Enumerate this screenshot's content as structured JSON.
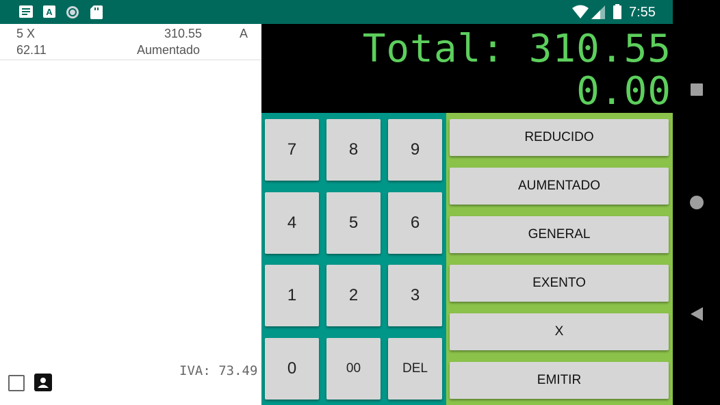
{
  "status_bar": {
    "time": "7:55",
    "icons": [
      "notes-icon",
      "font-icon",
      "sync-icon",
      "sd-card-icon",
      "wifi-icon",
      "signal-icon",
      "battery-icon"
    ]
  },
  "list": {
    "items": [
      {
        "qty": "5 X",
        "price": "62.11",
        "amount": "310.55",
        "type": "Aumentado",
        "code": "A"
      }
    ],
    "iva_text": "IVA: 73.49"
  },
  "display": {
    "total_text": "Total: 310.55",
    "input_text": "0.00"
  },
  "keypad": {
    "keys": [
      "7",
      "8",
      "9",
      "4",
      "5",
      "6",
      "1",
      "2",
      "3",
      "0",
      "00",
      "DEL"
    ]
  },
  "actions": {
    "buttons": [
      "REDUCIDO",
      "AUMENTADO",
      "GENERAL",
      "EXENTO",
      "X",
      "EMITIR"
    ]
  },
  "colors": {
    "status_bar": "#00695c",
    "keypad_bg": "#009688",
    "actions_bg": "#8bc34a",
    "display_text": "#5ccf5c"
  }
}
